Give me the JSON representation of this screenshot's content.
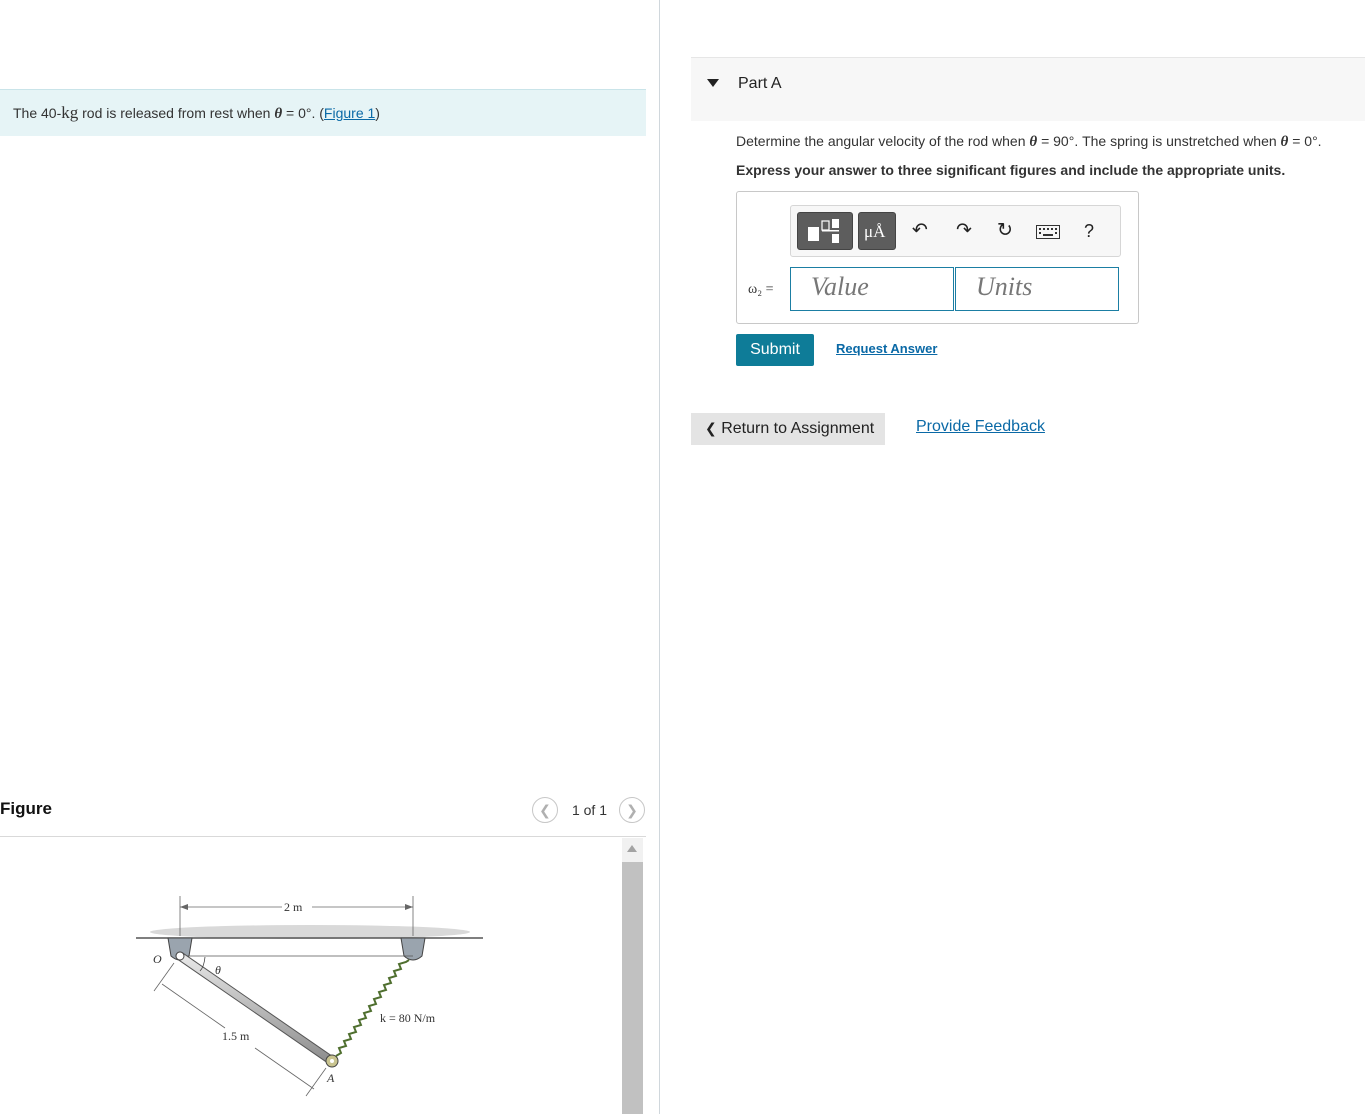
{
  "problem": {
    "text_before": "The 40-",
    "unit": "kg",
    "text_middle": " rod is released from rest when ",
    "theta": "θ",
    "equals": " = 0°. (",
    "figure_link": "Figure 1",
    "close_paren": ")"
  },
  "figure": {
    "title": "Figure",
    "pager": "1 of 1",
    "prev_icon": "chevron-left-icon",
    "next_icon": "chevron-right-icon",
    "labels": {
      "span": "2 m",
      "theta": "θ",
      "o": "O",
      "length": "1.5 m",
      "spring": "k = 80 N/m",
      "a": "A"
    }
  },
  "part": {
    "title": "Part A",
    "question_before": "Determine the angular velocity of the rod when ",
    "theta1": "θ",
    "question_mid": " = 90°. The spring is unstretched when ",
    "theta2": "θ",
    "question_end": " = 0°.",
    "instruction": "Express your answer to three significant figures and include the appropriate units."
  },
  "answer": {
    "variable": "ω₂ =",
    "value_placeholder": "Value",
    "units_placeholder": "Units",
    "toolbar": {
      "templates_icon": "templates-icon",
      "units_label": "μÅ",
      "undo_icon": "undo-icon",
      "redo_icon": "redo-icon",
      "reset_icon": "reset-icon",
      "keyboard_icon": "keyboard-icon",
      "help_label": "?"
    }
  },
  "actions": {
    "submit": "Submit",
    "request_answer": "Request Answer",
    "return": "Return to Assignment",
    "feedback": "Provide Feedback"
  },
  "colors": {
    "accent": "#0e7c98",
    "link": "#0a69a6",
    "problem_bg": "#e6f4f6"
  }
}
